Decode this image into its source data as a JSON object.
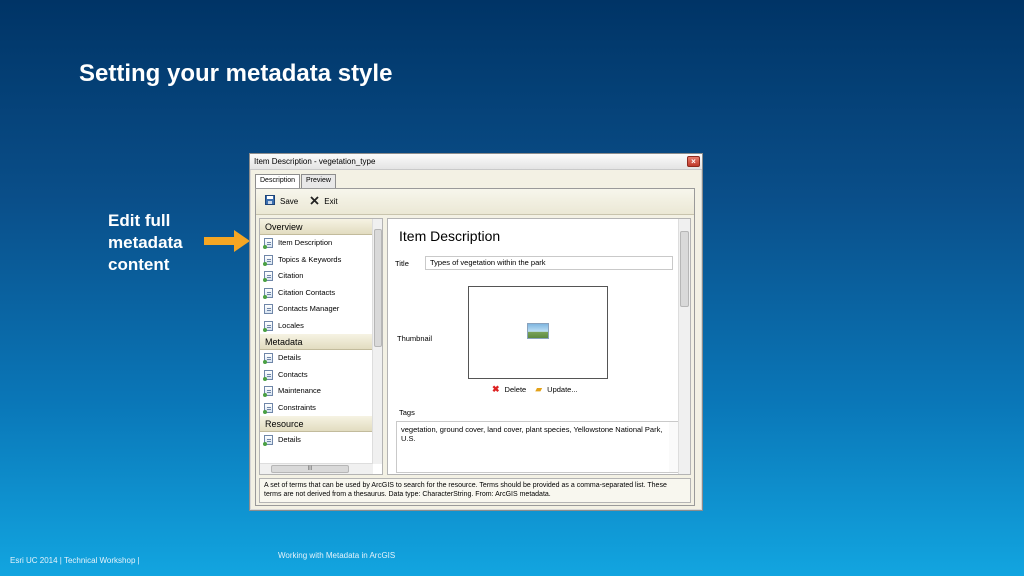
{
  "slide": {
    "title": "Setting your metadata style",
    "callout": "Edit full metadata content",
    "footer_left": "Esri UC 2014 | Technical Workshop |",
    "footer_center": "Working with Metadata in ArcGIS"
  },
  "window": {
    "title": "Item Description - vegetation_type",
    "close_glyph": "×",
    "tabs": [
      {
        "label": "Description",
        "active": true
      },
      {
        "label": "Preview",
        "active": false
      }
    ],
    "toolbar": {
      "save_label": "Save",
      "exit_label": "Exit"
    },
    "nav": {
      "sections": [
        {
          "header": "Overview",
          "items": [
            "Item Description",
            "Topics & Keywords",
            "Citation",
            "Citation Contacts",
            "Contacts Manager",
            "Locales"
          ]
        },
        {
          "header": "Metadata",
          "items": [
            "Details",
            "Contacts",
            "Maintenance",
            "Constraints"
          ]
        },
        {
          "header": "Resource",
          "items": [
            "Details"
          ]
        }
      ],
      "hscroll_glyph": "III"
    },
    "content": {
      "heading": "Item Description",
      "title_label": "Title",
      "title_value": "Types of vegetation within the park",
      "thumbnail_label": "Thumbnail",
      "delete_label": "Delete",
      "update_label": "Update...",
      "tags_label": "Tags",
      "tags_value": "vegetation, ground cover, land cover, plant species, Yellowstone National Park, U.S."
    },
    "description_bar": "A set of terms that can be used by ArcGIS to search for the resource. Terms should be provided as a comma-separated list. These terms are not derived from a thesaurus. Data type: CharacterString. From: ArcGIS metadata."
  },
  "colors": {
    "background_top": "#003466",
    "background_bottom": "#12a5e0",
    "arrow": "#f5a623"
  }
}
